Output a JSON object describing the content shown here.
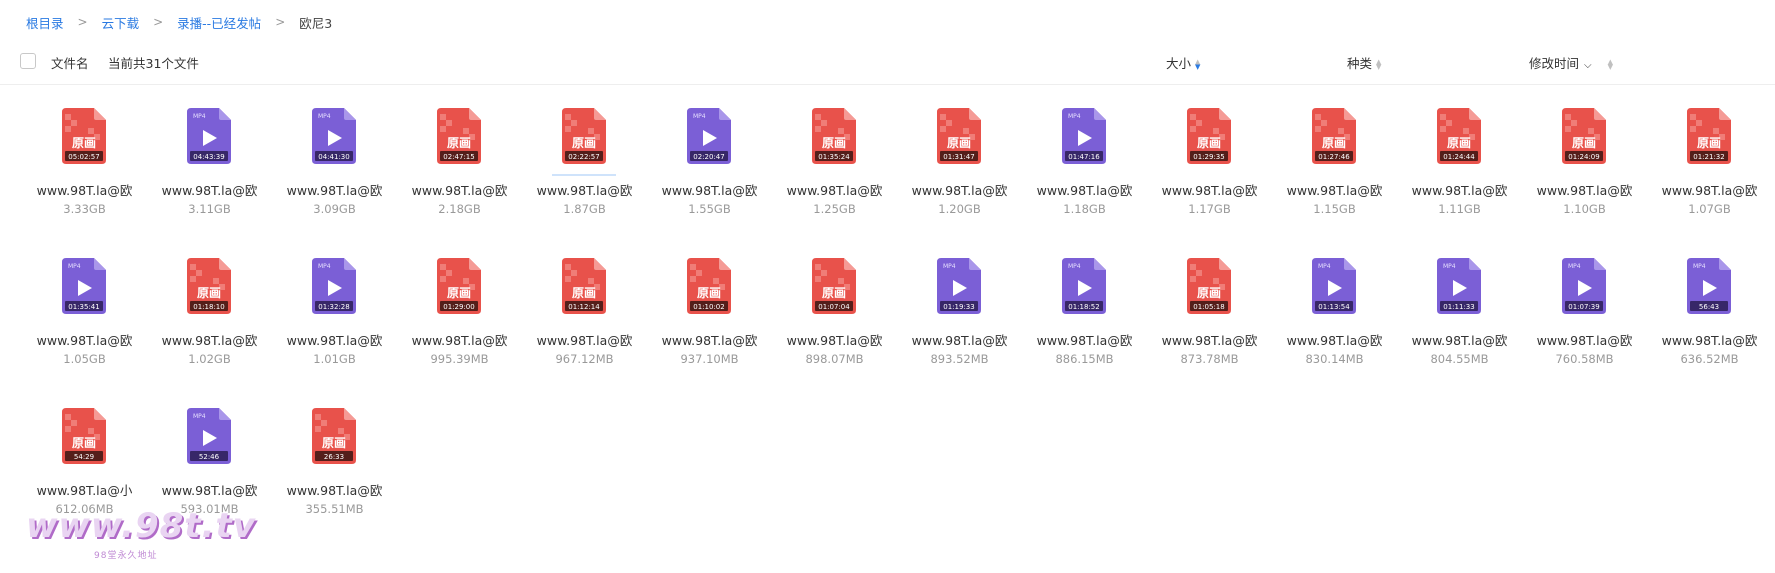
{
  "breadcrumb": {
    "items": [
      "根目录",
      "云下载",
      "录播--已经发帖"
    ],
    "current": "欧尼3"
  },
  "header": {
    "name_label": "文件名",
    "count_text": "当前共31个文件",
    "size_label": "大小",
    "type_label": "种类",
    "mtime_label": "修改时间"
  },
  "colors": {
    "link": "#2a7ae2",
    "red_file": "#e8524b",
    "purple_file": "#7b5fd6"
  },
  "files": [
    {
      "kind": "yuanhua",
      "duration": "05:02:57",
      "name": "www.98T.la@欧",
      "size": "3.33GB"
    },
    {
      "kind": "mp4",
      "duration": "04:43:39",
      "name": "www.98T.la@欧",
      "size": "3.11GB"
    },
    {
      "kind": "mp4",
      "duration": "04:41:30",
      "name": "www.98T.la@欧",
      "size": "3.09GB"
    },
    {
      "kind": "yuanhua",
      "duration": "02:47:15",
      "name": "www.98T.la@欧",
      "size": "2.18GB"
    },
    {
      "kind": "yuanhua",
      "duration": "02:22:57",
      "name": "www.98T.la@欧",
      "size": "1.87GB"
    },
    {
      "kind": "mp4",
      "duration": "02:20:47",
      "name": "www.98T.la@欧",
      "size": "1.55GB"
    },
    {
      "kind": "yuanhua",
      "duration": "01:35:24",
      "name": "www.98T.la@欧",
      "size": "1.25GB"
    },
    {
      "kind": "yuanhua",
      "duration": "01:31:47",
      "name": "www.98T.la@欧",
      "size": "1.20GB"
    },
    {
      "kind": "mp4",
      "duration": "01:47:16",
      "name": "www.98T.la@欧",
      "size": "1.18GB"
    },
    {
      "kind": "yuanhua",
      "duration": "01:29:35",
      "name": "www.98T.la@欧",
      "size": "1.17GB"
    },
    {
      "kind": "yuanhua",
      "duration": "01:27:46",
      "name": "www.98T.la@欧",
      "size": "1.15GB"
    },
    {
      "kind": "yuanhua",
      "duration": "01:24:44",
      "name": "www.98T.la@欧",
      "size": "1.11GB"
    },
    {
      "kind": "yuanhua",
      "duration": "01:24:09",
      "name": "www.98T.la@欧",
      "size": "1.10GB"
    },
    {
      "kind": "yuanhua",
      "duration": "01:21:32",
      "name": "www.98T.la@欧",
      "size": "1.07GB"
    },
    {
      "kind": "mp4",
      "duration": "01:35:41",
      "name": "www.98T.la@欧",
      "size": "1.05GB"
    },
    {
      "kind": "yuanhua",
      "duration": "01:18:10",
      "name": "www.98T.la@欧",
      "size": "1.02GB"
    },
    {
      "kind": "mp4",
      "duration": "01:32:28",
      "name": "www.98T.la@欧",
      "size": "1.01GB"
    },
    {
      "kind": "yuanhua",
      "duration": "01:29:00",
      "name": "www.98T.la@欧",
      "size": "995.39MB"
    },
    {
      "kind": "yuanhua",
      "duration": "01:12:14",
      "name": "www.98T.la@欧",
      "size": "967.12MB"
    },
    {
      "kind": "yuanhua",
      "duration": "01:10:02",
      "name": "www.98T.la@欧",
      "size": "937.10MB"
    },
    {
      "kind": "yuanhua",
      "duration": "01:07:04",
      "name": "www.98T.la@欧",
      "size": "898.07MB"
    },
    {
      "kind": "mp4",
      "duration": "01:19:33",
      "name": "www.98T.la@欧",
      "size": "893.52MB"
    },
    {
      "kind": "mp4",
      "duration": "01:18:52",
      "name": "www.98T.la@欧",
      "size": "886.15MB"
    },
    {
      "kind": "yuanhua",
      "duration": "01:05:18",
      "name": "www.98T.la@欧",
      "size": "873.78MB"
    },
    {
      "kind": "mp4",
      "duration": "01:13:54",
      "name": "www.98T.la@欧",
      "size": "830.14MB"
    },
    {
      "kind": "mp4",
      "duration": "01:11:33",
      "name": "www.98T.la@欧",
      "size": "804.55MB"
    },
    {
      "kind": "mp4",
      "duration": "01:07:39",
      "name": "www.98T.la@欧",
      "size": "760.58MB"
    },
    {
      "kind": "mp4",
      "duration": "56:43",
      "name": "www.98T.la@欧",
      "size": "636.52MB"
    },
    {
      "kind": "yuanhua",
      "duration": "54:29",
      "name": "www.98T.la@小",
      "size": "612.06MB"
    },
    {
      "kind": "mp4",
      "duration": "52:46",
      "name": "www.98T.la@欧",
      "size": "593.01MB"
    },
    {
      "kind": "yuanhua",
      "duration": "26:33",
      "name": "www.98T.la@欧",
      "size": "355.51MB"
    }
  ],
  "icon_labels": {
    "yuanhua": "原画",
    "mp4": "MP4"
  },
  "watermark": {
    "text": "www.98t.tv",
    "sub": "98堂永久地址"
  }
}
